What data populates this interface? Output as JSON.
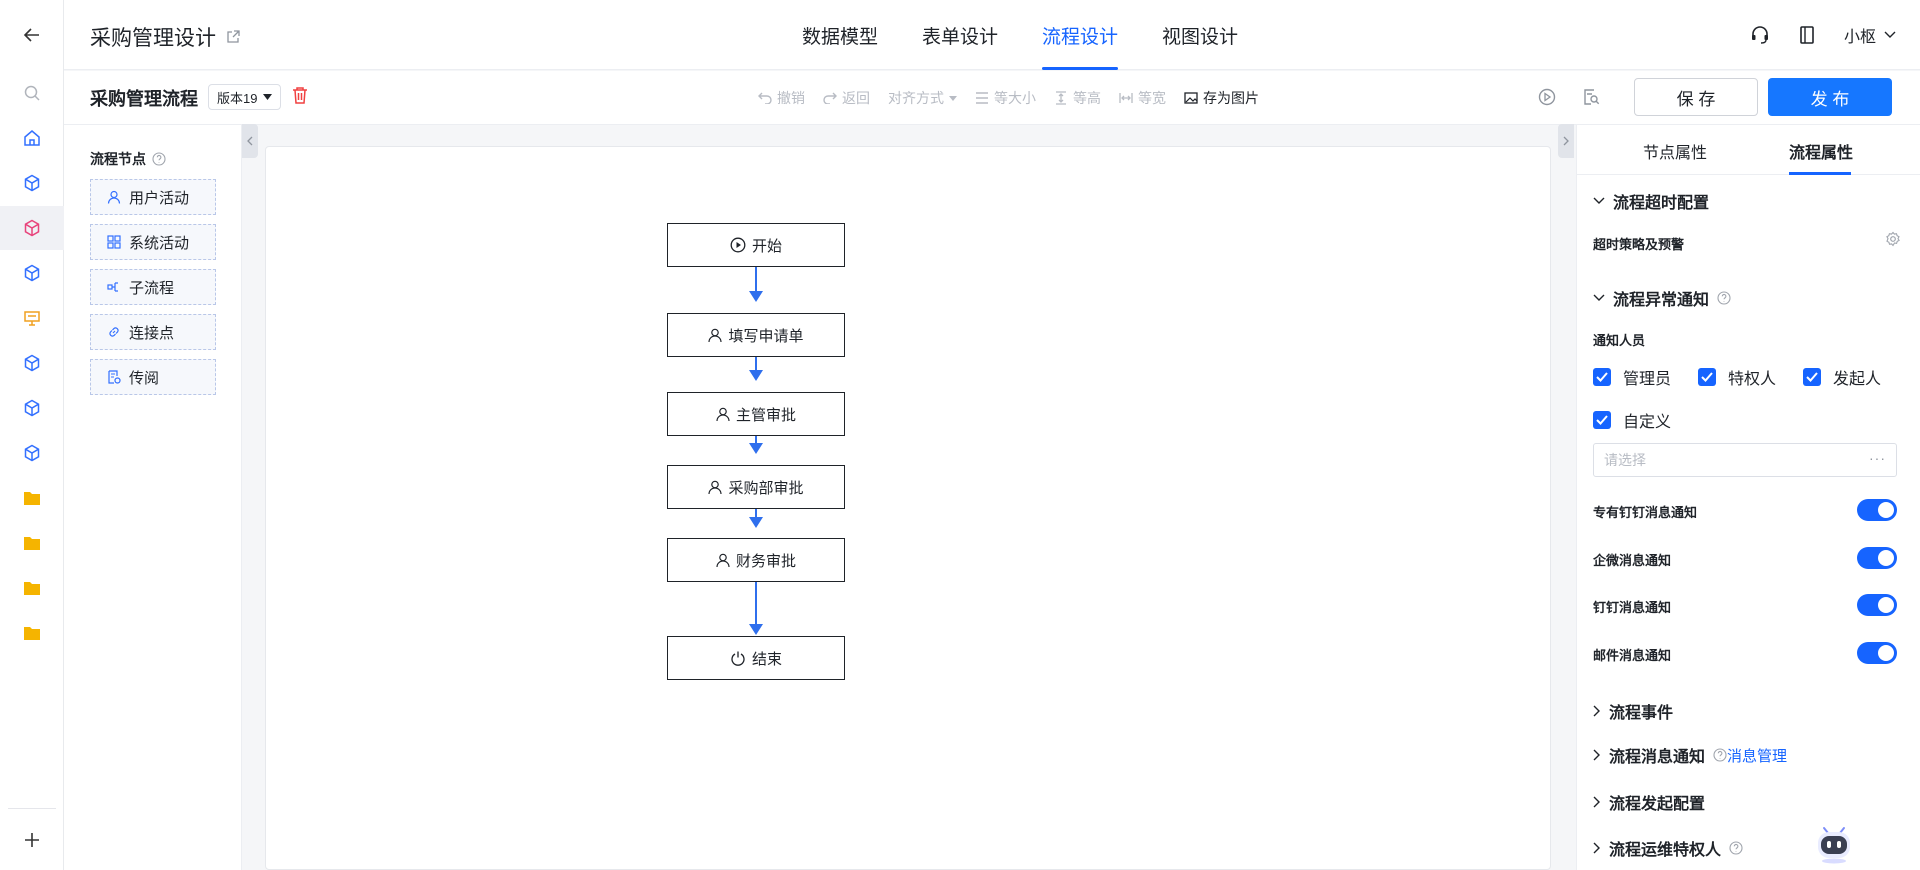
{
  "app": {
    "title": "采购管理设计"
  },
  "main_tabs": [
    {
      "label": "数据模型"
    },
    {
      "label": "表单设计"
    },
    {
      "label": "流程设计",
      "active": true
    },
    {
      "label": "视图设计"
    }
  ],
  "user": {
    "name": "小枢"
  },
  "toolbar": {
    "flow_name": "采购管理流程",
    "version": "版本19",
    "tools": [
      "撤销",
      "返回",
      "对齐方式",
      "等大小",
      "等高",
      "等宽",
      "存为图片"
    ],
    "save_label": "保 存",
    "publish_label": "发 布"
  },
  "palette": {
    "title": "流程节点",
    "items": [
      {
        "label": "用户活动",
        "icon": "user-icon"
      },
      {
        "label": "系统活动",
        "icon": "grid-icon"
      },
      {
        "label": "子流程",
        "icon": "subprocess-icon"
      },
      {
        "label": "连接点",
        "icon": "link-icon"
      },
      {
        "label": "传阅",
        "icon": "circulate-icon"
      }
    ]
  },
  "flow": {
    "nodes": [
      {
        "label": "开始",
        "icon": "play-circle-icon"
      },
      {
        "label": "填写申请单",
        "icon": "user-icon"
      },
      {
        "label": "主管审批",
        "icon": "user-icon"
      },
      {
        "label": "采购部审批",
        "icon": "user-icon"
      },
      {
        "label": "财务审批",
        "icon": "user-icon"
      },
      {
        "label": "结束",
        "icon": "power-icon"
      }
    ]
  },
  "props": {
    "tabs": [
      {
        "label": "节点属性"
      },
      {
        "label": "流程属性",
        "active": true
      }
    ],
    "timeout": {
      "title": "流程超时配置",
      "strategy_label": "超时策略及预警"
    },
    "exception": {
      "title": "流程异常通知",
      "notify_label": "通知人员",
      "checkboxes": [
        "管理员",
        "特权人",
        "发起人",
        "自定义"
      ],
      "select_placeholder": "请选择",
      "select_more": "···",
      "switches": [
        {
          "label": "专有钉钉消息通知",
          "on": true
        },
        {
          "label": "企微消息通知",
          "on": true
        },
        {
          "label": "钉钉消息通知",
          "on": true
        },
        {
          "label": "邮件消息通知",
          "on": true
        }
      ]
    },
    "sections": [
      {
        "title": "流程事件"
      },
      {
        "title": "流程消息通知",
        "link": "消息管理"
      },
      {
        "title": "流程发起配置"
      },
      {
        "title": "流程运维特权人"
      }
    ]
  },
  "colors": {
    "accent": "#1664ff",
    "edge": "#2f6fed",
    "danger": "#f04040"
  }
}
